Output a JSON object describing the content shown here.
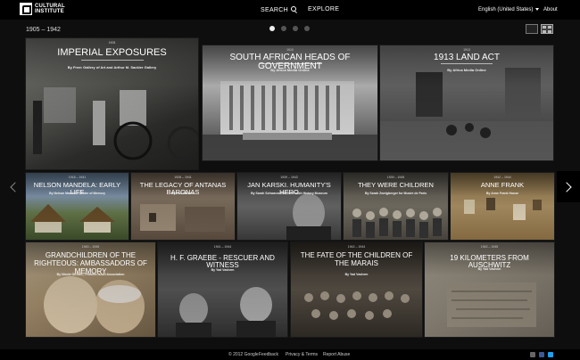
{
  "header": {
    "logo_line1": "CULTURAL",
    "logo_line2": "INSTITUTE",
    "search_label": "SEARCH",
    "explore_label": "EXPLORE",
    "language": "English (United States)",
    "about_label": "About"
  },
  "period": "1905 – 1942",
  "pager": {
    "count": 4,
    "active": 1
  },
  "tiles": [
    {
      "title": "IMPERIAL EXPOSURES",
      "date": "1905",
      "by": "By Freer Gallery of Art and Arthur M. Sackler Gallery"
    },
    {
      "title": "SOUTH AFRICAN HEADS OF GOVERNMENT",
      "date": "1910",
      "by": "By Africa Media Online"
    },
    {
      "title": "1913 LAND ACT",
      "date": "1913",
      "by": "By Africa Media Online"
    },
    {
      "title": "NELSON MANDELA: EARLY LIFE",
      "date": "1918 – 1941",
      "by": "By Nelson Mandela Centre of Memory"
    },
    {
      "title": "THE LEGACY OF ANTANAS BARONAS",
      "date": "1928 – 1941",
      "by": "By Yad Vashem"
    },
    {
      "title": "JAN KARSKI. HUMANITY'S HERO",
      "date": "1939 – 1943",
      "by": "By Sarah Schwarzschild for Polish History Museum"
    },
    {
      "title": "THEY WERE CHILDREN",
      "date": "1939 – 1945",
      "by": "By Sarah Zweigberger for Musée de Paris"
    },
    {
      "title": "ANNE FRANK",
      "date": "1942 – 1944",
      "by": "By Anne Frank House"
    },
    {
      "title": "GRANDCHILDREN OF THE RIGHTEOUS: AMBASSADORS OF MEMORY",
      "date": "1940 – 1945",
      "by": "By Nicole GEISEL, Primero Israel Association"
    },
    {
      "title": "H. F. GRAEBE - RESCUER AND WITNESS",
      "date": "1941 – 1944",
      "by": "By Yad Vashem"
    },
    {
      "title": "THE FATE OF THE CHILDREN OF THE MARAIS",
      "date": "1942 – 1944",
      "by": "By Yad Vashem"
    },
    {
      "title": "19 KILOMETERS FROM AUSCHWITZ",
      "date": "1942 – 1945",
      "by": "By Yad Vashem"
    }
  ],
  "footer": {
    "copyright": "© 2012 Google",
    "feedback": "Feedback",
    "privacy": "Privacy & Terms",
    "report": "Report Abuse"
  },
  "colors": {
    "background": "#0e0e0e",
    "bar": "#000000",
    "facebook": "#3b5998",
    "twitter": "#1da1f2",
    "gplus": "#dd4b39"
  }
}
